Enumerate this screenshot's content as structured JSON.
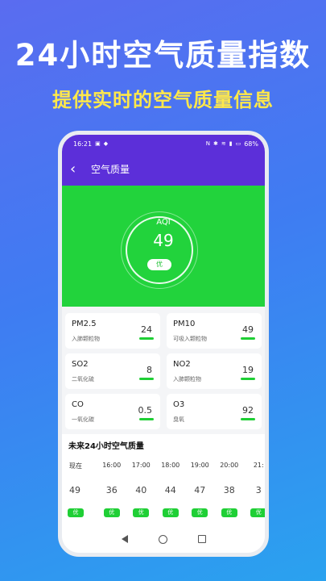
{
  "promo": {
    "title": "24小时空气质量指数",
    "subtitle": "提供实时的空气质量信息"
  },
  "statusbar": {
    "time": "16:21",
    "battery": "68%"
  },
  "appbar": {
    "title": "空气质量"
  },
  "aqi": {
    "label": "AQI",
    "value": "49",
    "level": "优",
    "color": "#22d33c"
  },
  "pollutants": [
    {
      "name": "PM2.5",
      "desc": "入肺颗粒物",
      "value": "24"
    },
    {
      "name": "PM10",
      "desc": "可吸入颗粒物",
      "value": "49"
    },
    {
      "name": "SO2",
      "desc": "二氧化硫",
      "value": "8"
    },
    {
      "name": "NO2",
      "desc": "入肺颗粒物",
      "value": "19"
    },
    {
      "name": "CO",
      "desc": "一氧化碳",
      "value": "0.5"
    },
    {
      "name": "O3",
      "desc": "臭氧",
      "value": "92"
    }
  ],
  "forecast": {
    "title": "未来24小时空气质量",
    "hours": [
      {
        "time": "现在",
        "value": "49",
        "level": "优"
      },
      {
        "time": "16:00",
        "value": "36",
        "level": "优"
      },
      {
        "time": "17:00",
        "value": "40",
        "level": "优"
      },
      {
        "time": "18:00",
        "value": "44",
        "level": "优"
      },
      {
        "time": "19:00",
        "value": "47",
        "level": "优"
      },
      {
        "time": "20:00",
        "value": "38",
        "level": "优"
      },
      {
        "time": "21:",
        "value": "3",
        "level": "优"
      }
    ]
  },
  "colors": {
    "header": "#5c2fd9",
    "good": "#1fcf35"
  }
}
